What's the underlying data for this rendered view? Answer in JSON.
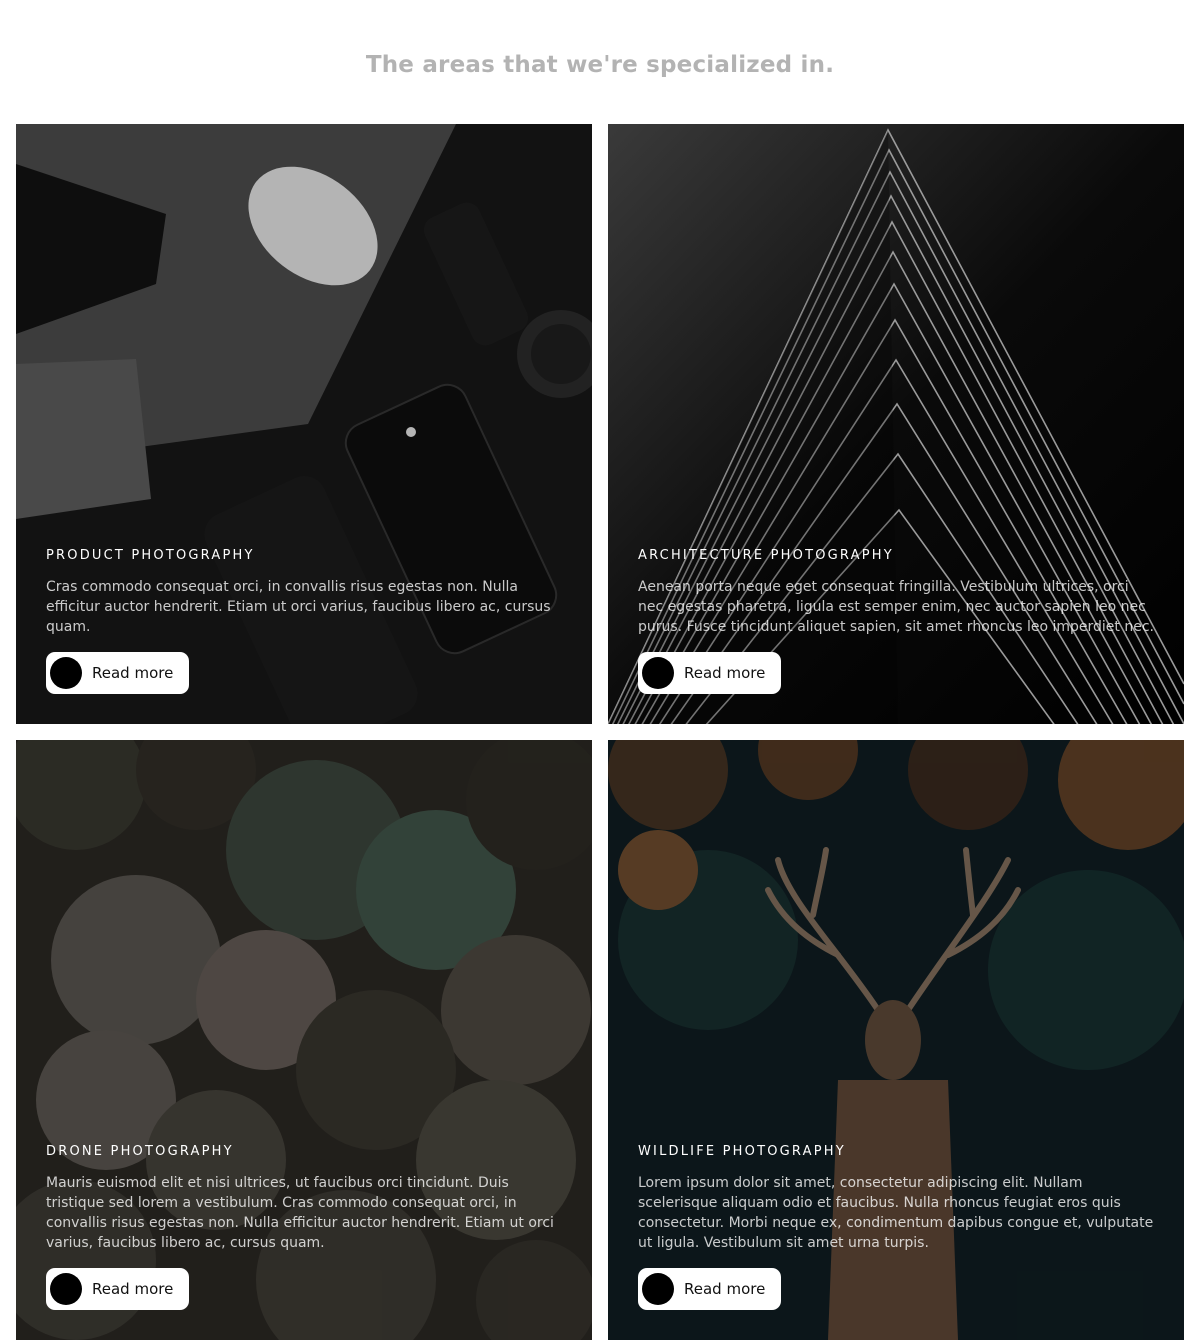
{
  "heading": "The areas that we're specialized in.",
  "cards": [
    {
      "title": "PRODUCT PHOTOGRAPHY",
      "description": "Cras commodo consequat orci, in convallis risus egestas non. Nulla efficitur auctor hendrerit. Etiam ut orci varius, faucibus libero ac, cursus quam.",
      "button_label": "Read more"
    },
    {
      "title": "ARCHITECTURE PHOTOGRAPHY",
      "description": "Aenean porta neque eget consequat fringilla. Vestibulum ultrices, orci nec egestas pharetra, ligula est semper enim, nec auctor sapien leo nec purus. Fusce tincidunt aliquet sapien, sit amet rhoncus leo imperdiet nec.",
      "button_label": "Read more"
    },
    {
      "title": "DRONE PHOTOGRAPHY",
      "description": "Mauris euismod elit et nisi ultrices, ut faucibus orci tincidunt. Duis tristique sed lorem a vestibulum. Cras commodo consequat orci, in convallis risus egestas non. Nulla efficitur auctor hendrerit. Etiam ut orci varius, faucibus libero ac, cursus quam.",
      "button_label": "Read more"
    },
    {
      "title": "WILDLIFE PHOTOGRAPHY",
      "description": "Lorem ipsum dolor sit amet, consectetur adipiscing elit. Nullam scelerisque aliquam odio et faucibus. Nulla rhoncus feugiat eros quis consectetur. Morbi neque ex, condimentum dapibus congue et, vulputate ut ligula. Vestibulum sit amet urna turpis.",
      "button_label": "Read more"
    }
  ]
}
